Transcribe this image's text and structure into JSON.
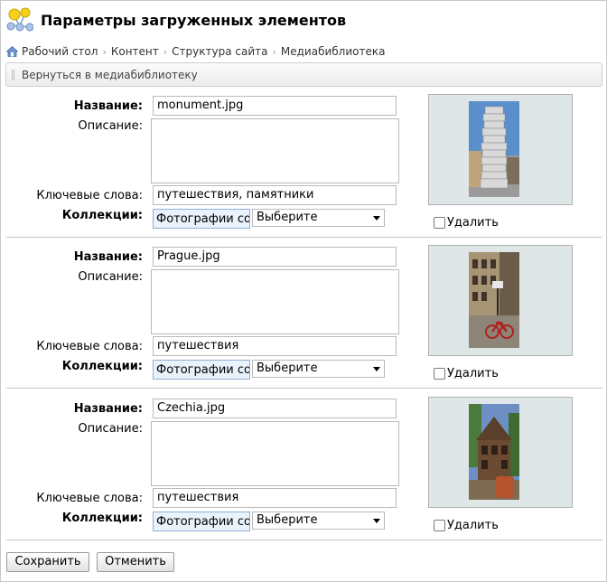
{
  "title": "Параметры загруженных элементов",
  "breadcrumb": [
    "Рабочий стол",
    "Контент",
    "Структура сайта",
    "Медиабиблиотека"
  ],
  "toolbar": {
    "back_label": "Вернуться в медиабиблиотеку"
  },
  "labels": {
    "name": "Название:",
    "description": "Описание:",
    "keywords": "Ключевые слова:",
    "collections": "Коллекции:",
    "delete": "Удалить"
  },
  "items": [
    {
      "name": "monument.jpg",
      "description": "",
      "keywords": "путешествия, памятники",
      "collection": "Фотографии со",
      "select": "Выберите"
    },
    {
      "name": "Prague.jpg",
      "description": "",
      "keywords": "путешествия",
      "collection": "Фотографии со",
      "select": "Выберите"
    },
    {
      "name": "Czechia.jpg",
      "description": "",
      "keywords": "путешествия",
      "collection": "Фотографии со",
      "select": "Выберите"
    }
  ],
  "buttons": {
    "save": "Сохранить",
    "cancel": "Отменить"
  }
}
